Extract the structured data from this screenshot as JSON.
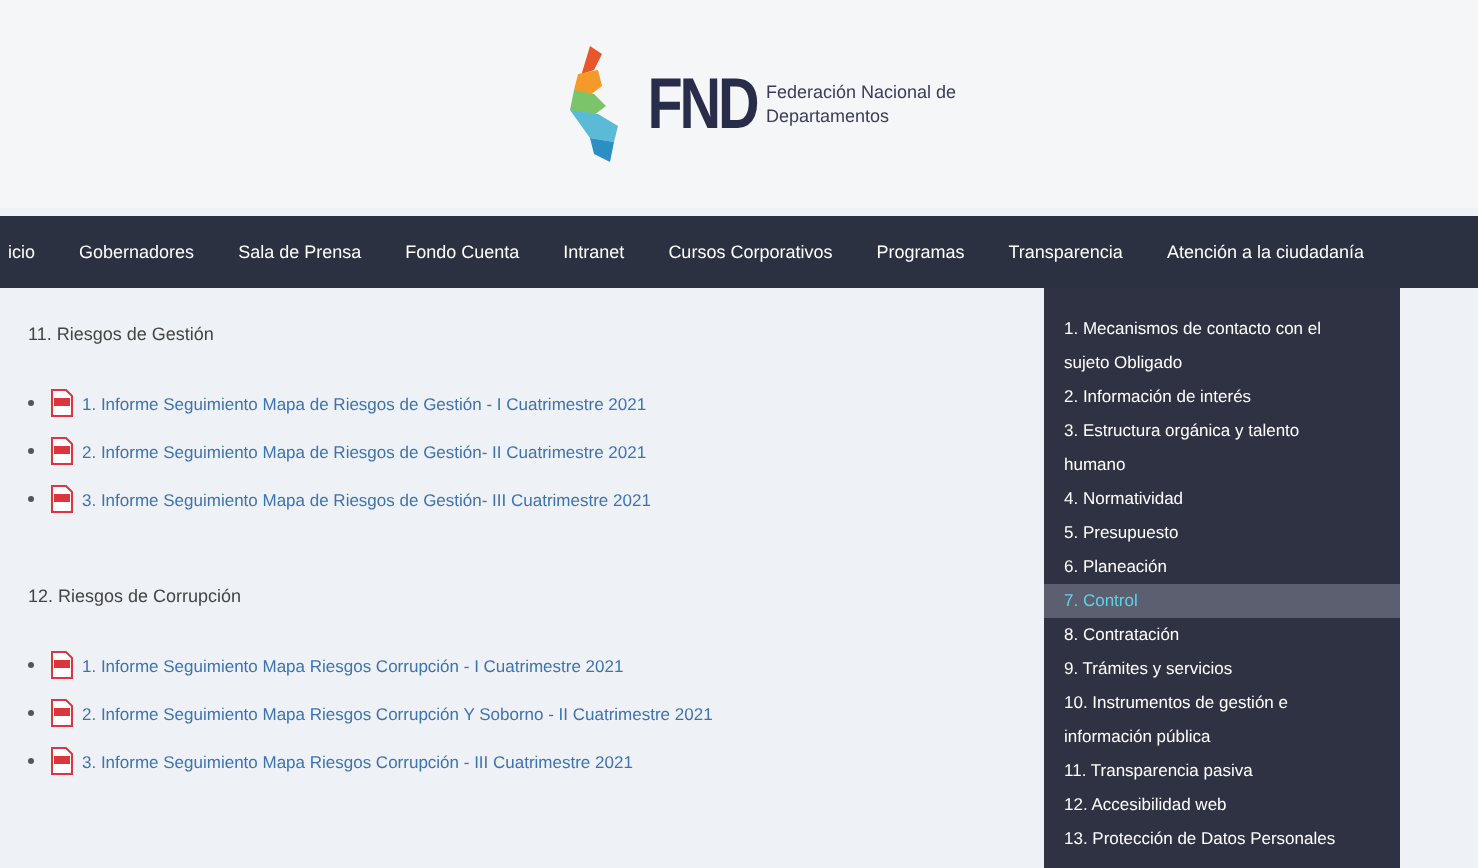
{
  "logo": {
    "mark": "FND",
    "subtitle": [
      "Federación Nacional de",
      "Departamentos"
    ]
  },
  "nav": [
    "icio",
    "Gobernadores",
    "Sala de Prensa",
    "Fondo Cuenta",
    "Intranet",
    "Cursos Corporativos",
    "Programas",
    "Transparencia",
    "Atención a la ciudadanía"
  ],
  "sections": [
    {
      "title": "11. Riesgos de Gestión",
      "links": [
        "1. Informe Seguimiento Mapa de Riesgos de Gestión - I Cuatrimestre 2021",
        "2. Informe Seguimiento Mapa de Riesgos de Gestión- II Cuatrimestre 2021",
        "3. Informe Seguimiento Mapa de Riesgos de Gestión- III Cuatrimestre 2021"
      ]
    },
    {
      "title": "12. Riesgos de Corrupción",
      "links": [
        "1. Informe Seguimiento Mapa Riesgos Corrupción - I Cuatrimestre 2021",
        "2. Informe Seguimiento Mapa Riesgos Corrupción Y Soborno - II Cuatrimestre 2021",
        "3. Informe Seguimiento Mapa Riesgos Corrupción - III Cuatrimestre 2021"
      ]
    }
  ],
  "dropdown": [
    {
      "label": "1. Mecanismos de contacto con el sujeto Obligado",
      "selected": false
    },
    {
      "label": "2. Información de interés",
      "selected": false
    },
    {
      "label": "3. Estructura orgánica y talento humano",
      "selected": false
    },
    {
      "label": "4. Normatividad",
      "selected": false
    },
    {
      "label": "5. Presupuesto",
      "selected": false
    },
    {
      "label": "6. Planeación",
      "selected": false
    },
    {
      "label": "7. Control",
      "selected": true
    },
    {
      "label": "8. Contratación",
      "selected": false
    },
    {
      "label": "9. Trámites y servicios",
      "selected": false
    },
    {
      "label": "10. Instrumentos de gestión e información pública",
      "selected": false
    },
    {
      "label": "11. Transparencia pasiva",
      "selected": false
    },
    {
      "label": "12. Accesibilidad web",
      "selected": false
    },
    {
      "label": "13. Protección de Datos Personales",
      "selected": false
    }
  ]
}
